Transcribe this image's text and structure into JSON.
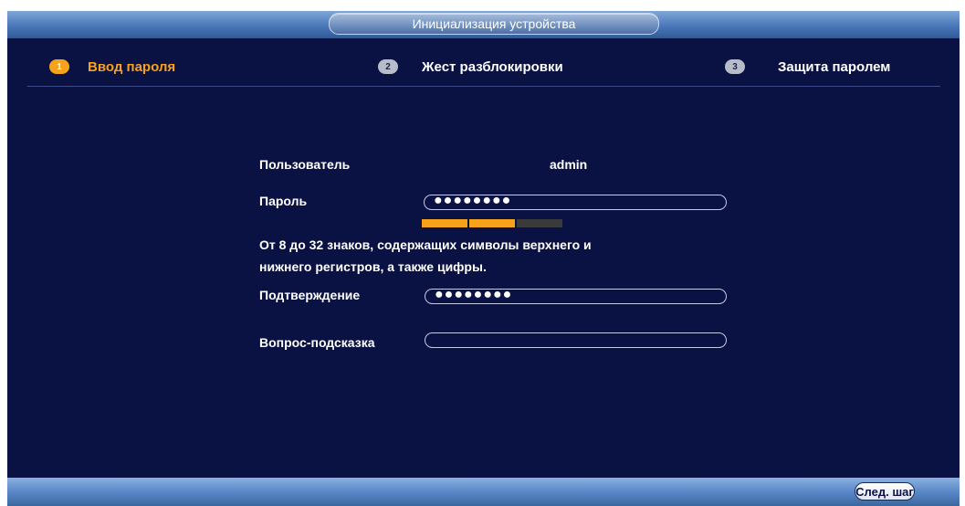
{
  "window": {
    "title": "Инициализация устройства"
  },
  "steps": [
    {
      "number": "1",
      "label": "Ввод пароля",
      "active": true
    },
    {
      "number": "2",
      "label": "Жест разблокировки",
      "active": false
    },
    {
      "number": "3",
      "label": "Защита паролем",
      "active": false
    }
  ],
  "form": {
    "user_label": "Пользователь",
    "user_value": "admin",
    "password_label": "Пароль",
    "password_value": "●●●●●●●●",
    "password_strength": {
      "filled_segments": 2,
      "total_segments": 3
    },
    "hint_line1": "От 8 до 32 знаков, содержащих символы верхнего и",
    "hint_line2": "нижнего регистров, а также цифры.",
    "confirm_label": "Подтверждение",
    "confirm_value": "●●●●●●●●",
    "question_label": "Вопрос-подсказка",
    "question_value": ""
  },
  "footer": {
    "next_label": "След. шаг"
  },
  "colors": {
    "background": "#0a1244",
    "accent": "#f6a21a",
    "strength_empty": "#3a3a3a",
    "inactive_step": "#b8bcc8"
  }
}
